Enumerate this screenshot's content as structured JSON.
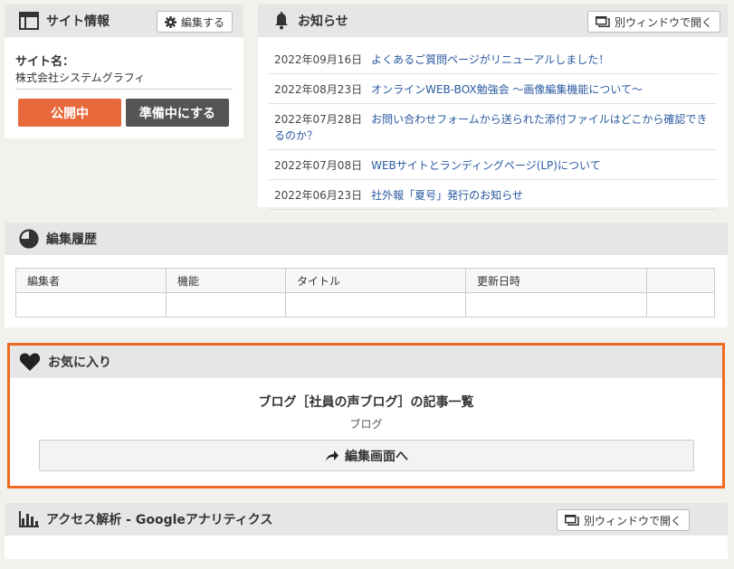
{
  "site": {
    "title": "サイト情報",
    "edit_label": "編集する",
    "name_label": "サイト名：",
    "name_value": "株式会社システムグラフィ",
    "public_label": "公開中",
    "prepare_label": "準備中にする"
  },
  "news": {
    "title": "お知らせ",
    "open_window_label": "別ウィンドウで開く",
    "items": [
      {
        "date": "2022年09月16日",
        "text": "よくあるご質問ページがリニューアルしました！"
      },
      {
        "date": "2022年08月23日",
        "text": "オンラインWEB-BOX勉強会 ～画像編集機能について～"
      },
      {
        "date": "2022年07月28日",
        "text": "お問い合わせフォームから送られた添付ファイルはどこから確認できるのか？"
      },
      {
        "date": "2022年07月08日",
        "text": "WEBサイトとランディングページ(LP)について"
      },
      {
        "date": "2022年06月23日",
        "text": "社外報「夏号」発行のお知らせ"
      }
    ]
  },
  "history": {
    "title": "編集履歴",
    "columns": [
      "編集者",
      "機能",
      "タイトル",
      "更新日時",
      ""
    ]
  },
  "favorite": {
    "title": "お気に入り",
    "item_title": "ブログ［社員の声ブログ］の記事一覧",
    "item_sub": "ブログ",
    "edit_button": "編集画面へ",
    "border_color": "#f26a22"
  },
  "analytics": {
    "title": "アクセス解析 - Googleアナリティクス",
    "open_window_label": "別ウィンドウで開く"
  }
}
